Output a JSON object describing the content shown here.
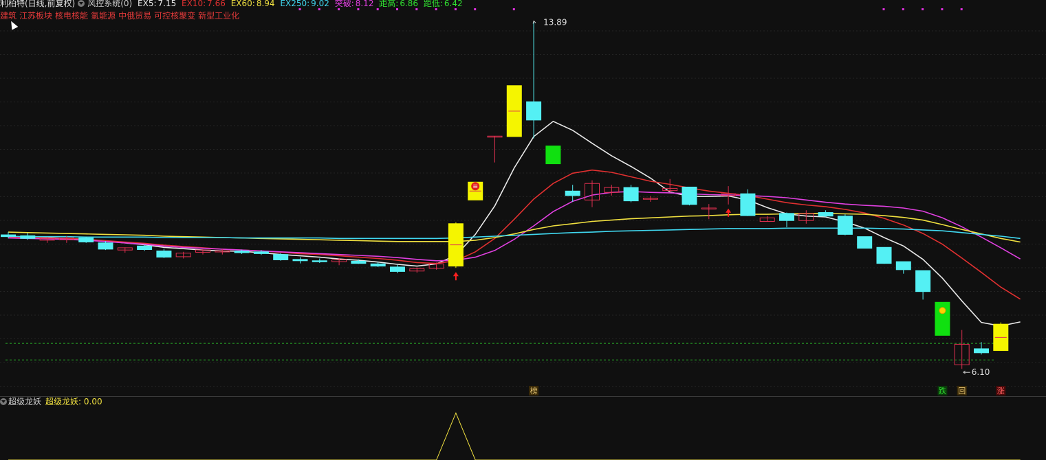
{
  "header": {
    "title": "利柏特(日线,前复权)",
    "indicator_name": "风控系统(0)",
    "ex5_label": "EX5:",
    "ex5_value": "7.15",
    "ex10_label": "EX10:",
    "ex10_value": "7.66",
    "ex60_label": "EX60:",
    "ex60_value": "8.94",
    "ex250_label": "EX250:",
    "ex250_value": "9.02",
    "tupo_label": "突破:",
    "tupo_value": "8.12",
    "jugao_label": "距高:",
    "jugao_value": "6.86",
    "judi_label": "距低:",
    "judi_value": "6.42",
    "colors": {
      "ex5": "#e8e8e8",
      "ex10": "#e03030",
      "ex60": "#f0e040",
      "ex250": "#40d8f0",
      "tupo": "#e040e0",
      "jugao": "#30e030",
      "judi": "#30e030"
    }
  },
  "concepts": [
    "建筑",
    "江苏板块",
    "核电核能",
    "氢能源",
    "中俄贸易",
    "可控核聚变",
    "新型工业化"
  ],
  "sub_panel": {
    "name": "超级龙妖",
    "label": "超级龙妖:",
    "value": "0.00"
  },
  "chart_data": [
    {
      "type": "candlestick",
      "y_range": [
        5.75,
        14.05
      ],
      "max_label": "13.89",
      "min_label": "6.10",
      "max_index": 27,
      "min_index": 49,
      "candles": [
        {
          "o": 9.1,
          "h": 9.16,
          "l": 9.02,
          "c": 9.06,
          "s": "down"
        },
        {
          "o": 9.08,
          "h": 9.14,
          "l": 8.99,
          "c": 9.02,
          "s": "down"
        },
        {
          "o": 8.98,
          "h": 9.05,
          "l": 8.92,
          "c": 9.02,
          "s": "up"
        },
        {
          "o": 8.99,
          "h": 9.07,
          "l": 8.92,
          "c": 9.03,
          "s": "up"
        },
        {
          "o": 9.03,
          "h": 9.06,
          "l": 8.92,
          "c": 8.94,
          "s": "down"
        },
        {
          "o": 8.92,
          "h": 8.96,
          "l": 8.76,
          "c": 8.78,
          "s": "down"
        },
        {
          "o": 8.76,
          "h": 8.82,
          "l": 8.7,
          "c": 8.81,
          "s": "up"
        },
        {
          "o": 8.85,
          "h": 8.88,
          "l": 8.74,
          "c": 8.77,
          "s": "down"
        },
        {
          "o": 8.74,
          "h": 8.79,
          "l": 8.58,
          "c": 8.6,
          "s": "down"
        },
        {
          "o": 8.61,
          "h": 8.72,
          "l": 8.57,
          "c": 8.69,
          "s": "up"
        },
        {
          "o": 8.71,
          "h": 8.78,
          "l": 8.66,
          "c": 8.76,
          "s": "up"
        },
        {
          "o": 8.72,
          "h": 8.78,
          "l": 8.66,
          "c": 8.74,
          "s": "up"
        },
        {
          "o": 8.74,
          "h": 8.77,
          "l": 8.67,
          "c": 8.7,
          "s": "down"
        },
        {
          "o": 8.72,
          "h": 8.76,
          "l": 8.65,
          "c": 8.68,
          "s": "down"
        },
        {
          "o": 8.66,
          "h": 8.69,
          "l": 8.52,
          "c": 8.54,
          "s": "down"
        },
        {
          "o": 8.55,
          "h": 8.6,
          "l": 8.46,
          "c": 8.52,
          "s": "down"
        },
        {
          "o": 8.52,
          "h": 8.57,
          "l": 8.47,
          "c": 8.5,
          "s": "down"
        },
        {
          "o": 8.5,
          "h": 8.58,
          "l": 8.42,
          "c": 8.54,
          "s": "up"
        },
        {
          "o": 8.51,
          "h": 8.55,
          "l": 8.45,
          "c": 8.46,
          "s": "down"
        },
        {
          "o": 8.45,
          "h": 8.49,
          "l": 8.38,
          "c": 8.4,
          "s": "down"
        },
        {
          "o": 8.38,
          "h": 8.43,
          "l": 8.24,
          "c": 8.28,
          "s": "down"
        },
        {
          "o": 8.29,
          "h": 8.37,
          "l": 8.25,
          "c": 8.34,
          "s": "up"
        },
        {
          "o": 8.35,
          "h": 8.48,
          "l": 8.32,
          "c": 8.45,
          "s": "up"
        },
        {
          "o": 8.4,
          "h": 9.38,
          "l": 8.36,
          "c": 9.35,
          "s": "limit"
        },
        {
          "o": 10.28,
          "h": 10.28,
          "l": 10.28,
          "c": 10.28,
          "s": "limit"
        },
        {
          "o": 11.31,
          "h": 11.31,
          "l": 10.72,
          "c": 11.31,
          "s": "up"
        },
        {
          "o": 11.3,
          "h": 12.44,
          "l": 11.3,
          "c": 12.44,
          "s": "limit"
        },
        {
          "o": 12.08,
          "h": 13.89,
          "l": 11.26,
          "c": 11.67,
          "s": "down"
        },
        {
          "o": 11.09,
          "h": 11.09,
          "l": 11.09,
          "c": 11.09,
          "s": "limitdown"
        },
        {
          "o": 10.08,
          "h": 10.22,
          "l": 9.84,
          "c": 9.98,
          "s": "down"
        },
        {
          "o": 9.88,
          "h": 10.32,
          "l": 9.72,
          "c": 10.25,
          "s": "up"
        },
        {
          "o": 10.05,
          "h": 10.22,
          "l": 9.98,
          "c": 10.16,
          "s": "up"
        },
        {
          "o": 10.16,
          "h": 10.22,
          "l": 9.83,
          "c": 9.86,
          "s": "down"
        },
        {
          "o": 9.92,
          "h": 9.97,
          "l": 9.84,
          "c": 9.92,
          "s": "up"
        },
        {
          "o": 10.09,
          "h": 10.35,
          "l": 10.05,
          "c": 10.14,
          "s": "up"
        },
        {
          "o": 10.17,
          "h": 10.17,
          "l": 9.76,
          "c": 9.78,
          "s": "down"
        },
        {
          "o": 9.7,
          "h": 9.79,
          "l": 9.45,
          "c": 9.7,
          "s": "up"
        },
        {
          "o": 9.98,
          "h": 10.19,
          "l": 9.78,
          "c": 10.02,
          "s": "up"
        },
        {
          "o": 10.02,
          "h": 10.12,
          "l": 9.52,
          "c": 9.53,
          "s": "down"
        },
        {
          "o": 9.4,
          "h": 9.52,
          "l": 9.4,
          "c": 9.48,
          "s": "up"
        },
        {
          "o": 9.58,
          "h": 9.6,
          "l": 9.27,
          "c": 9.42,
          "s": "down"
        },
        {
          "o": 9.42,
          "h": 9.65,
          "l": 9.35,
          "c": 9.58,
          "s": "up"
        },
        {
          "o": 9.6,
          "h": 9.65,
          "l": 9.5,
          "c": 9.52,
          "s": "down"
        },
        {
          "o": 9.52,
          "h": 9.56,
          "l": 9.09,
          "c": 9.11,
          "s": "down"
        },
        {
          "o": 9.06,
          "h": 9.06,
          "l": 8.8,
          "c": 8.8,
          "s": "down"
        },
        {
          "o": 8.82,
          "h": 8.82,
          "l": 8.45,
          "c": 8.46,
          "s": "down"
        },
        {
          "o": 8.5,
          "h": 8.5,
          "l": 8.23,
          "c": 8.32,
          "s": "down"
        },
        {
          "o": 8.3,
          "h": 8.3,
          "l": 7.65,
          "c": 7.83,
          "s": "down"
        },
        {
          "o": 7.59,
          "h": 7.59,
          "l": 6.85,
          "c": 6.85,
          "s": "limitdown"
        },
        {
          "o": 6.65,
          "h": 6.97,
          "l": 6.1,
          "c": 6.19,
          "s": "up"
        },
        {
          "o": 6.55,
          "h": 6.7,
          "l": 6.42,
          "c": 6.46,
          "s": "down"
        },
        {
          "o": 6.51,
          "h": 7.14,
          "l": 6.51,
          "c": 7.1,
          "s": "limit"
        }
      ],
      "ma_series": [
        {
          "name": "EX5",
          "color": "#e8e8e8",
          "values": [
            9.06,
            9.05,
            9.04,
            9.02,
            9.0,
            8.96,
            8.92,
            8.88,
            8.82,
            8.79,
            8.76,
            8.74,
            8.73,
            8.7,
            8.66,
            8.63,
            8.6,
            8.56,
            8.53,
            8.49,
            8.44,
            8.4,
            8.45,
            8.64,
            9.11,
            9.75,
            10.6,
            11.3,
            11.64,
            11.44,
            11.15,
            10.87,
            10.63,
            10.37,
            10.06,
            9.96,
            9.96,
            9.97,
            9.88,
            9.71,
            9.57,
            9.52,
            9.5,
            9.39,
            9.25,
            9.04,
            8.85,
            8.55,
            8.13,
            7.62,
            7.14,
            7.06,
            7.15
          ]
        },
        {
          "name": "EX10",
          "color": "#e03030",
          "values": [
            9.05,
            9.04,
            9.03,
            9.02,
            9.0,
            8.97,
            8.94,
            8.91,
            8.87,
            8.84,
            8.81,
            8.78,
            8.76,
            8.74,
            8.71,
            8.68,
            8.66,
            8.63,
            8.6,
            8.57,
            8.53,
            8.48,
            8.46,
            8.52,
            8.72,
            9.02,
            9.45,
            9.9,
            10.25,
            10.48,
            10.55,
            10.5,
            10.4,
            10.3,
            10.23,
            10.15,
            10.08,
            10.03,
            9.98,
            9.9,
            9.82,
            9.77,
            9.73,
            9.67,
            9.59,
            9.47,
            9.32,
            9.13,
            8.89,
            8.58,
            8.26,
            7.93,
            7.66
          ]
        },
        {
          "name": "Tupo",
          "color": "#e040e0",
          "values": [
            9.03,
            9.02,
            9.01,
            9.0,
            8.98,
            8.95,
            8.92,
            8.89,
            8.85,
            8.82,
            8.8,
            8.78,
            8.76,
            8.74,
            8.72,
            8.7,
            8.68,
            8.66,
            8.64,
            8.62,
            8.59,
            8.55,
            8.52,
            8.53,
            8.6,
            8.75,
            9.0,
            9.3,
            9.62,
            9.85,
            9.99,
            10.05,
            10.07,
            10.05,
            10.04,
            10.02,
            10.0,
            9.99,
            9.98,
            9.96,
            9.93,
            9.88,
            9.83,
            9.79,
            9.76,
            9.74,
            9.7,
            9.63,
            9.48,
            9.28,
            9.05,
            8.81,
            8.56
          ]
        },
        {
          "name": "EX60",
          "color": "#f0e040",
          "values": [
            9.16,
            9.15,
            9.14,
            9.13,
            9.12,
            9.11,
            9.1,
            9.09,
            9.07,
            9.06,
            9.05,
            9.04,
            9.03,
            9.02,
            9.01,
            9.0,
            8.99,
            8.98,
            8.97,
            8.96,
            8.95,
            8.95,
            8.95,
            8.95,
            8.98,
            9.04,
            9.12,
            9.22,
            9.3,
            9.35,
            9.4,
            9.43,
            9.46,
            9.48,
            9.5,
            9.52,
            9.53,
            9.55,
            9.56,
            9.56,
            9.57,
            9.58,
            9.58,
            9.57,
            9.56,
            9.53,
            9.49,
            9.43,
            9.33,
            9.22,
            9.12,
            9.02,
            8.94
          ]
        },
        {
          "name": "EX250",
          "color": "#40d8f0",
          "values": [
            9.07,
            9.06,
            9.06,
            9.06,
            9.05,
            9.05,
            9.05,
            9.05,
            9.04,
            9.04,
            9.04,
            9.04,
            9.03,
            9.03,
            9.03,
            9.03,
            9.03,
            9.02,
            9.02,
            9.02,
            9.02,
            9.02,
            9.02,
            9.03,
            9.05,
            9.07,
            9.09,
            9.11,
            9.13,
            9.15,
            9.16,
            9.18,
            9.19,
            9.2,
            9.21,
            9.22,
            9.23,
            9.24,
            9.24,
            9.24,
            9.25,
            9.25,
            9.25,
            9.25,
            9.25,
            9.24,
            9.23,
            9.21,
            9.19,
            9.15,
            9.11,
            9.07,
            9.02
          ]
        }
      ],
      "stop_lines": [
        6.67,
        6.3
      ],
      "markers": [
        {
          "i": 23,
          "type": "up-arrow"
        },
        {
          "i": 24,
          "type": "shan-badge"
        },
        {
          "i": 37,
          "type": "up-arrow"
        },
        {
          "i": 48,
          "type": "gold-dot"
        }
      ],
      "top_dots": [
        15,
        16,
        17,
        18,
        19,
        20,
        21,
        22,
        23,
        24,
        26,
        45,
        46,
        47,
        48,
        49
      ],
      "bottom_labels": [
        {
          "i": 27,
          "text": "榜",
          "color": "#e0c070",
          "bg": "#3a2a08"
        },
        {
          "i": 48,
          "text": "跌",
          "color": "#30e030",
          "bg": "#0a3a0a"
        },
        {
          "i": 49,
          "text": "回",
          "color": "#e0c070",
          "bg": "#3a2a08"
        },
        {
          "i": 51,
          "text": "涨",
          "color": "#ff6060",
          "bg": "#4a0a0a"
        }
      ]
    },
    {
      "type": "line",
      "name": "超级龙妖",
      "color": "#f0e040",
      "y_range": [
        0,
        1
      ],
      "values": [
        0,
        0,
        0,
        0,
        0,
        0,
        0,
        0,
        0,
        0,
        0,
        0,
        0,
        0,
        0,
        0,
        0,
        0,
        0,
        0,
        0,
        0,
        0,
        0.95,
        0,
        0,
        0,
        0,
        0,
        0,
        0,
        0,
        0,
        0,
        0,
        0,
        0,
        0,
        0,
        0,
        0,
        0,
        0,
        0,
        0,
        0,
        0,
        0,
        0,
        0,
        0,
        0,
        0
      ]
    }
  ]
}
